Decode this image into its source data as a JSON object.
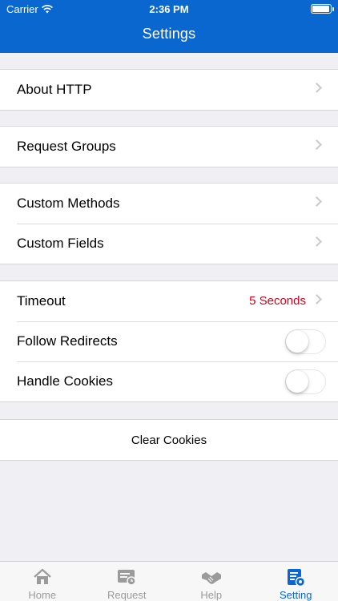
{
  "status_bar": {
    "carrier": "Carrier",
    "time": "2:36 PM"
  },
  "nav": {
    "title": "Settings"
  },
  "groups": [
    {
      "rows": [
        {
          "label": "About HTTP"
        }
      ]
    },
    {
      "rows": [
        {
          "label": "Request Groups"
        }
      ]
    },
    {
      "rows": [
        {
          "label": "Custom Methods"
        },
        {
          "label": "Custom Fields"
        }
      ]
    },
    {
      "rows": [
        {
          "label": "Timeout",
          "value": "5 Seconds"
        },
        {
          "label": "Follow Redirects",
          "toggle_on": false
        },
        {
          "label": "Handle Cookies",
          "toggle_on": false
        }
      ]
    },
    {
      "rows": [
        {
          "label": "Clear Cookies"
        }
      ]
    }
  ],
  "tabbar": {
    "tabs": [
      {
        "label": "Home",
        "icon": "home-icon"
      },
      {
        "label": "Request",
        "icon": "request-icon"
      },
      {
        "label": "Help",
        "icon": "handshake-icon"
      },
      {
        "label": "Setting",
        "icon": "setting-icon"
      }
    ],
    "active": "Setting"
  },
  "colors": {
    "accent": "#0a67cf",
    "detail": "#d0021b",
    "background": "#efeff4"
  }
}
